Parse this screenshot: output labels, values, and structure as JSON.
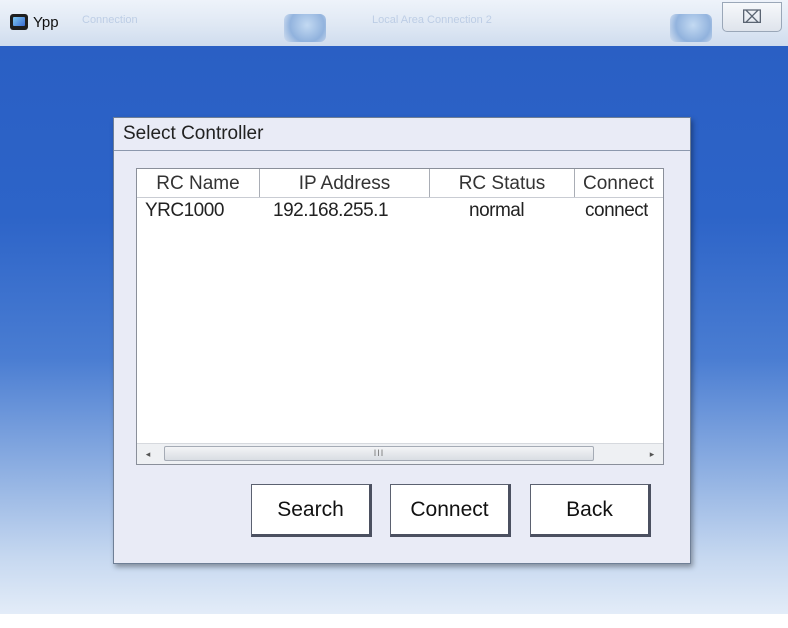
{
  "window": {
    "title": "Ypp",
    "close_glyph": "⌧",
    "background_tabs": [
      "Connection",
      "Local Area Connection 2"
    ]
  },
  "dialog": {
    "title": "Select Controller",
    "columns": [
      "RC Name",
      "IP Address",
      "RC Status",
      "Connect"
    ],
    "rows": [
      {
        "rc_name": "YRC1000",
        "ip_address": "192.168.255.1",
        "rc_status": "normal",
        "connect": "connect"
      }
    ],
    "scrollbar": {
      "left_arrow": "◂",
      "right_arrow": "▸",
      "grip": "III"
    },
    "buttons": {
      "search": "Search",
      "connect": "Connect",
      "back": "Back"
    }
  },
  "colors": {
    "desktop_blue": "#2a5fc4",
    "dialog_bg": "#e9ebf6",
    "titlebar_bg": "#dfe8f4"
  }
}
